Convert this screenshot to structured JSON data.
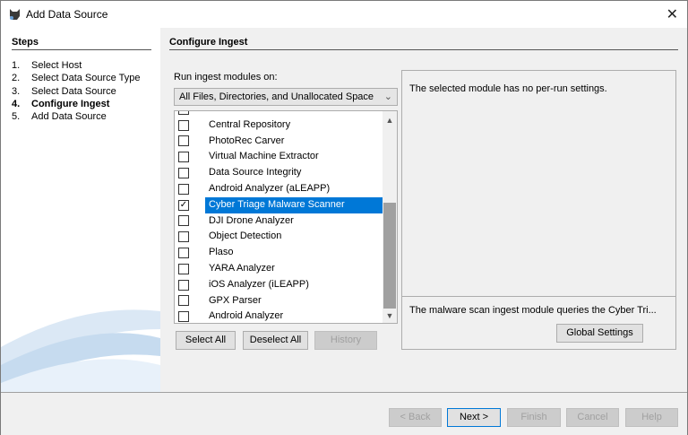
{
  "window": {
    "title": "Add Data Source",
    "close_icon": "close-icon"
  },
  "steps": {
    "heading": "Steps",
    "items": [
      {
        "num": "1.",
        "label": "Select Host"
      },
      {
        "num": "2.",
        "label": "Select Data Source Type"
      },
      {
        "num": "3.",
        "label": "Select Data Source"
      },
      {
        "num": "4.",
        "label": "Configure Ingest",
        "current": true
      },
      {
        "num": "5.",
        "label": "Add Data Source"
      }
    ]
  },
  "main": {
    "heading": "Configure Ingest",
    "run_on_label": "Run ingest modules on:",
    "run_on_value": "All Files, Directories, and Unallocated Space",
    "modules": [
      {
        "label": "Central Repository",
        "checked": false
      },
      {
        "label": "PhotoRec Carver",
        "checked": false
      },
      {
        "label": "Virtual Machine Extractor",
        "checked": false
      },
      {
        "label": "Data Source Integrity",
        "checked": false
      },
      {
        "label": "Android Analyzer (aLEAPP)",
        "checked": false
      },
      {
        "label": "Cyber Triage Malware Scanner",
        "checked": true,
        "selected": true
      },
      {
        "label": "DJI Drone Analyzer",
        "checked": false
      },
      {
        "label": "Object Detection",
        "checked": false
      },
      {
        "label": "Plaso",
        "checked": false
      },
      {
        "label": "YARA Analyzer",
        "checked": false
      },
      {
        "label": "iOS Analyzer (iLEAPP)",
        "checked": false
      },
      {
        "label": "GPX Parser",
        "checked": false
      },
      {
        "label": "Android Analyzer",
        "checked": false
      }
    ],
    "select_all": "Select All",
    "deselect_all": "Deselect All",
    "history": "History",
    "settings_message": "The selected module has no per-run settings.",
    "module_description": "The malware scan ingest module queries the Cyber Tri...",
    "global_settings": "Global Settings",
    "selection_color": "#0078d7"
  },
  "footer": {
    "back": "< Back",
    "next": "Next >",
    "finish": "Finish",
    "cancel": "Cancel",
    "help": "Help"
  }
}
